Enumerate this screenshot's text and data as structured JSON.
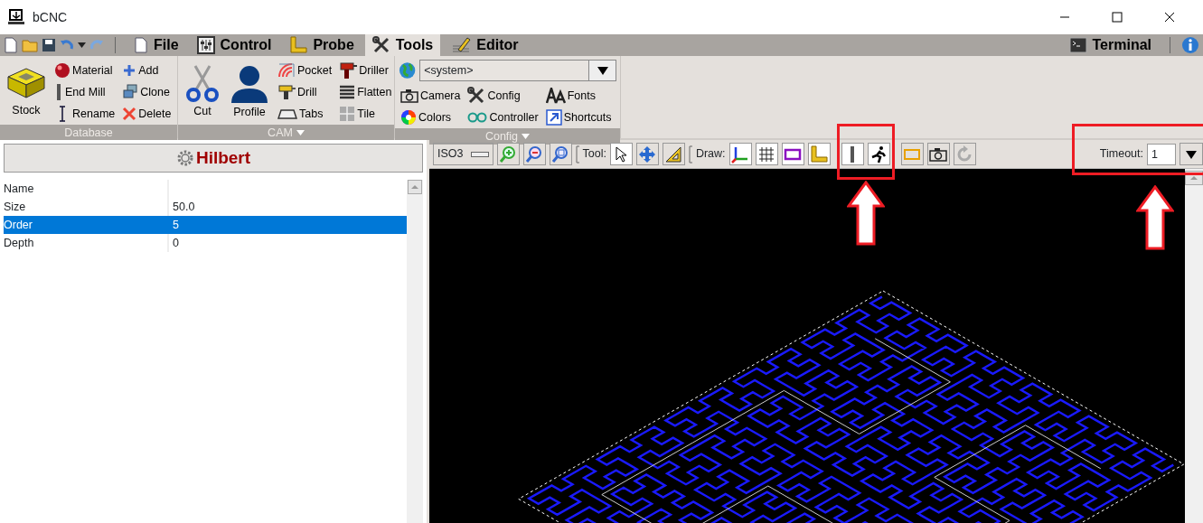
{
  "window": {
    "title": "bCNC"
  },
  "tabs": [
    {
      "label": "File",
      "selected": false
    },
    {
      "label": "Control",
      "selected": false
    },
    {
      "label": "Probe",
      "selected": false
    },
    {
      "label": "Tools",
      "selected": true
    },
    {
      "label": "Editor",
      "selected": false
    }
  ],
  "terminal": {
    "label": "Terminal"
  },
  "ribbon": {
    "groups": [
      {
        "label": "Database",
        "menu": false,
        "columns": [
          [
            {
              "label": "Stock"
            }
          ],
          [
            {
              "label": "Material"
            },
            {
              "label": "End Mill"
            },
            {
              "label": "Rename"
            }
          ],
          [
            {
              "label": "Add"
            },
            {
              "label": "Clone"
            },
            {
              "label": "Delete"
            }
          ]
        ]
      },
      {
        "label": "CAM",
        "menu": true,
        "columns": [
          [
            {
              "label": "Cut"
            }
          ],
          [
            {
              "label": "Profile"
            }
          ],
          [
            {
              "label": "Pocket"
            },
            {
              "label": "Drill"
            },
            {
              "label": "Tabs"
            }
          ],
          [
            {
              "label": "Driller"
            },
            {
              "label": "Flatten"
            },
            {
              "label": "Tile"
            }
          ]
        ]
      },
      {
        "label": "Config",
        "menu": true,
        "combo": "<system>",
        "columns": [
          [
            {
              "label": "Camera"
            },
            {
              "label": "Colors"
            }
          ],
          [
            {
              "label": "Config"
            },
            {
              "label": "Controller"
            }
          ],
          [
            {
              "label": "Fonts"
            },
            {
              "label": "Shortcuts"
            }
          ]
        ]
      }
    ]
  },
  "panel": {
    "title": "Hilbert",
    "rows": [
      {
        "name": "Name",
        "selected": false
      },
      {
        "name": "Size",
        "value": "50.0",
        "selected": false
      },
      {
        "name": "Order",
        "value": "5",
        "selected": true
      },
      {
        "name": "Depth",
        "value": "0",
        "selected": false
      }
    ]
  },
  "toolbar": {
    "view": "ISO3",
    "tool_label": "Tool:",
    "tools": [
      {
        "selected": true
      },
      {
        "selected": false
      },
      {
        "selected": false
      }
    ],
    "draw_label": "Draw:",
    "draw": [
      {
        "on": true
      },
      {
        "on": true
      },
      {
        "on": true
      },
      {
        "on": true
      },
      {
        "on": true
      },
      {
        "on": true
      },
      {
        "on": false
      },
      {
        "on": false
      },
      {
        "on": false
      }
    ],
    "timeout_label": "Timeout:",
    "timeout": "1"
  }
}
